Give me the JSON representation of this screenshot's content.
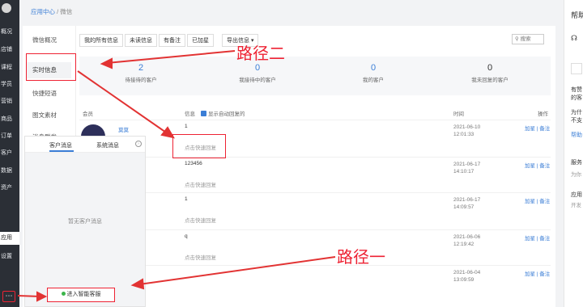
{
  "breadcrumb": {
    "parent": "应用中心",
    "sep": " / ",
    "current": "微信"
  },
  "leftnav": {
    "items": [
      "概况",
      "店铺",
      "课程",
      "学员",
      "营销",
      "商品",
      "订单",
      "客户",
      "数据",
      "资产",
      "应用",
      "设置"
    ],
    "active": "应用"
  },
  "submenu": {
    "items": [
      "微信概况",
      "实时信息",
      "快捷短语",
      "图文素材",
      "消息群发"
    ],
    "selected": "实时信息"
  },
  "tabs": [
    "我的所有信息",
    "未读信息",
    "有备注",
    "已加星",
    "导出信息 ▾"
  ],
  "search": {
    "placeholder": "搜索"
  },
  "stats": [
    {
      "value": "2",
      "label": "待接待的客户"
    },
    {
      "value": "0",
      "label": "我接待中的客户"
    },
    {
      "value": "0",
      "label": "我的客户"
    },
    {
      "value": "0",
      "label": "我未回复的客户"
    }
  ],
  "table": {
    "headers": {
      "member": "会员",
      "info": "信息",
      "autoreply": "显示自动回复的",
      "time": "时间",
      "ops": "操作"
    },
    "rows": [
      {
        "name": "莫莫",
        "msg": "1",
        "hint": "点击快速回复",
        "date": "2021-06-10",
        "clock": "12:01:33",
        "ops": "加星 | 备注"
      },
      {
        "msg": "123456",
        "hint": "点击快速回复",
        "date": "2021-06-17",
        "clock": "14:10:17",
        "ops": "加星 | 备注"
      },
      {
        "msg": "1",
        "hint": "点击快速回复",
        "date": "2021-06-17",
        "clock": "14:09:57",
        "ops": "加星 | 备注"
      },
      {
        "msg": "q",
        "hint": "点击快速回复",
        "date": "2021-06-06",
        "clock": "12:19:42",
        "ops": "加星 | 备注"
      },
      {
        "msg": "",
        "hint": "",
        "date": "2021-06-04",
        "clock": "13:09:59",
        "ops": "加星 | 备注"
      }
    ]
  },
  "chatpanel": {
    "tab1": "客户消息",
    "tab2": "系统消息",
    "empty": "暂无客户消息",
    "enter": "进入智能客服"
  },
  "annotations": {
    "path2": "路径二",
    "path1": "路径一"
  },
  "rightpanel": {
    "title": "帮助",
    "lines": [
      "有赞",
      "的客",
      "为什",
      "不支",
      "帮助",
      "服务",
      "为你",
      "应用",
      "开发"
    ]
  },
  "colors": {
    "accent": "#3b7ed6",
    "annotation": "#e23333",
    "nav": "#2b2f36"
  }
}
